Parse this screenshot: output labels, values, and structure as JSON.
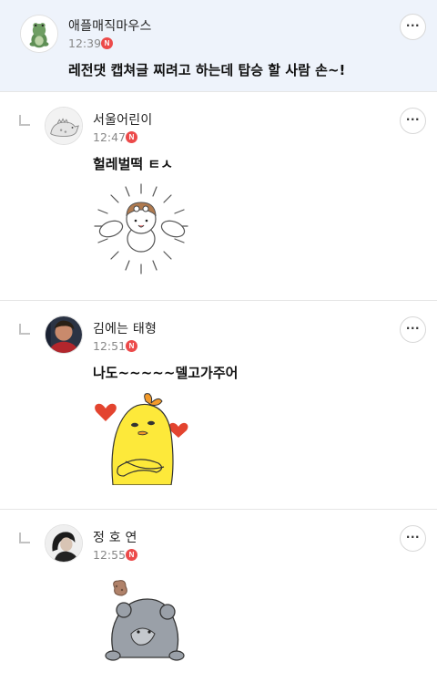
{
  "posts": [
    {
      "author": "애플매직마우스",
      "time": "12:39",
      "new_badge": "N",
      "text": "레전댓 캡쳐글 찌려고 하는데 탑승 할 사람 손~!",
      "avatar_icon": "frog-avatar-icon",
      "more_label": "···"
    },
    {
      "author": "서울어린이",
      "time": "12:47",
      "new_badge": "N",
      "text": "헐레벌떡 ㅌㅅ",
      "avatar_icon": "dinosaur-avatar-icon",
      "more_label": "···",
      "sticker": "running-puppy-sticker"
    },
    {
      "author": "김에는 태형",
      "time": "12:51",
      "new_badge": "N",
      "text": "나도~~~~~델고가주어",
      "avatar_icon": "person-photo-avatar",
      "more_label": "···",
      "sticker": "yellow-chick-hearts-sticker"
    },
    {
      "author": "정 호 연",
      "time": "12:55",
      "new_badge": "N",
      "avatar_icon": "person-photo-avatar",
      "more_label": "···",
      "sticker": "gray-bear-sticker"
    }
  ],
  "colors": {
    "main_post_bg": "#eef3fb",
    "new_badge": "#ec4a4a",
    "time_text": "#888888"
  }
}
